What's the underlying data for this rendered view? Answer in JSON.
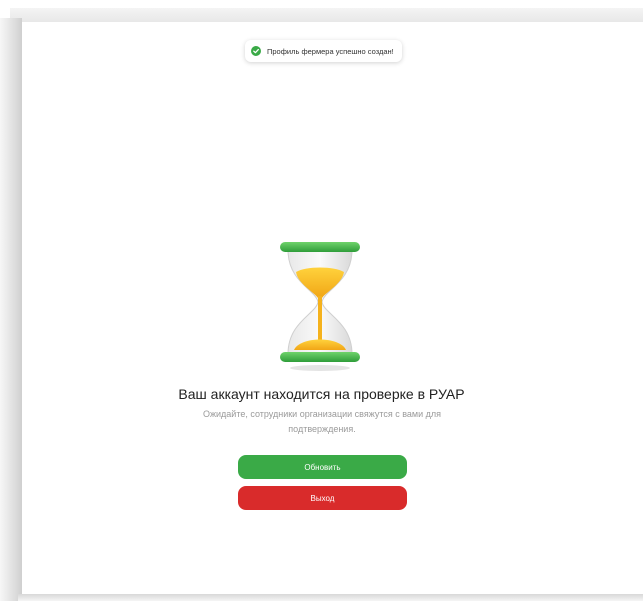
{
  "toast": {
    "message": "Профиль фермера успешно создан!",
    "icon": "check-circle-icon",
    "color": "#3aaa47"
  },
  "main": {
    "illustration": "hourglass-icon",
    "title": "Ваш аккаунт находится на проверке в РУАР",
    "subtitle": "Ожидайте, сотрудники организации свяжутся с вами для подтверждения."
  },
  "buttons": {
    "refresh_label": "Обновить",
    "refresh_color": "#3aaa47",
    "exit_label": "Выход",
    "exit_color": "#d92b2b"
  }
}
